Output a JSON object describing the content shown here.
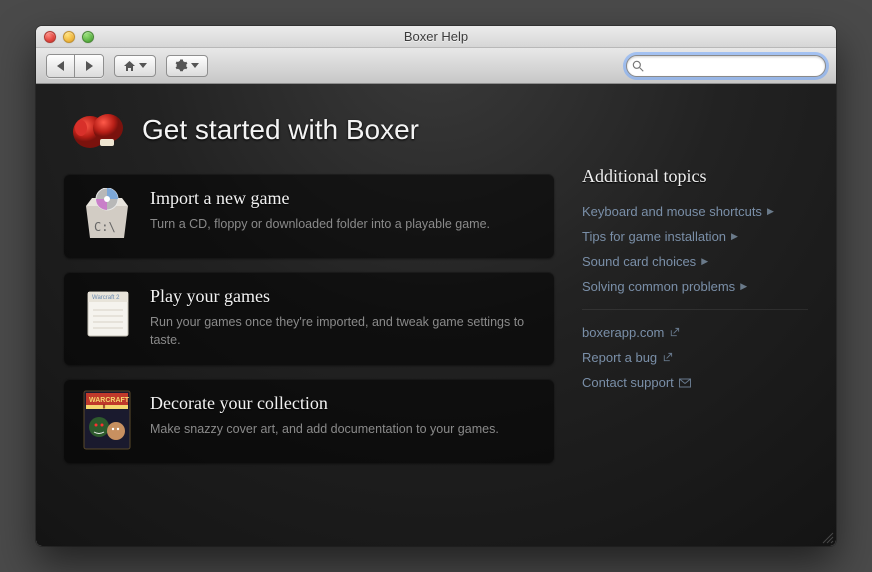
{
  "window": {
    "title": "Boxer Help"
  },
  "toolbar": {
    "search_placeholder": ""
  },
  "header": {
    "title": "Get started with Boxer"
  },
  "cards": [
    {
      "title": "Import a new game",
      "desc": "Turn a CD, floppy or downloaded folder into a playable game."
    },
    {
      "title": "Play your games",
      "desc": "Run your games once they're imported, and tweak game settings to taste."
    },
    {
      "title": "Decorate your collection",
      "desc": "Make snazzy cover art, and add documentation to your games."
    }
  ],
  "sidebar": {
    "heading": "Additional topics",
    "topics": [
      "Keyboard and mouse shortcuts",
      "Tips for game installation",
      "Sound card choices",
      "Solving common problems"
    ],
    "links": [
      "boxerapp.com",
      "Report a bug",
      "Contact support"
    ]
  }
}
